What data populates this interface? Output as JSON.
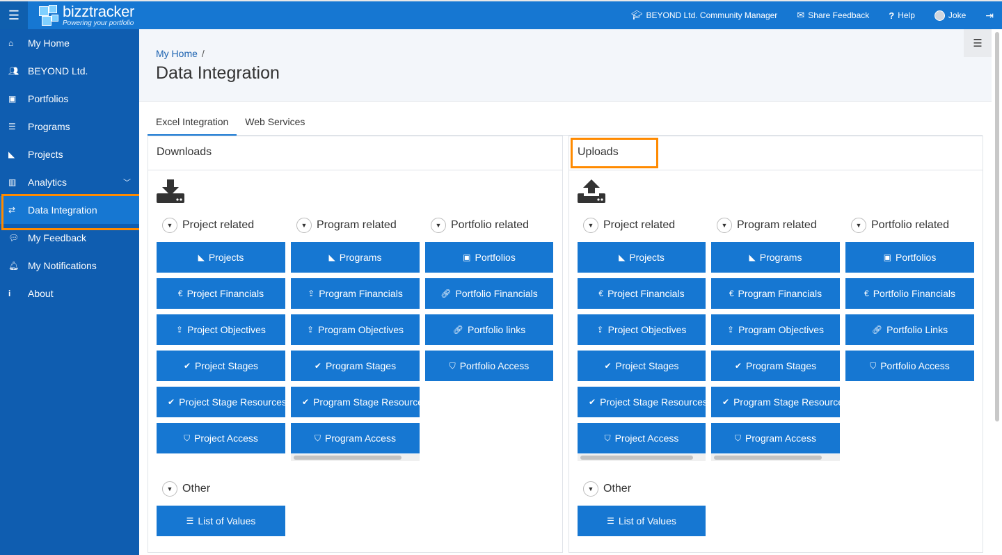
{
  "app": {
    "name": "bizztracker",
    "tagline": "Powering your portfolio"
  },
  "topbar": {
    "community": "BEYOND Ltd. Community Manager",
    "feedback": "Share Feedback",
    "help": "Help",
    "user": "Joke"
  },
  "sidebar": {
    "items": [
      {
        "label": "My Home",
        "icon": "home-icon"
      },
      {
        "label": "BEYOND Ltd.",
        "icon": "users-icon"
      },
      {
        "label": "Portfolios",
        "icon": "briefcase-icon"
      },
      {
        "label": "Programs",
        "icon": "list-icon"
      },
      {
        "label": "Projects",
        "icon": "area-chart-icon"
      },
      {
        "label": "Analytics",
        "icon": "bar-chart-icon"
      },
      {
        "label": "Data Integration",
        "icon": "exchange-icon"
      },
      {
        "label": "My Feedback",
        "icon": "comments-icon"
      },
      {
        "label": "My Notifications",
        "icon": "bell-icon"
      },
      {
        "label": "About",
        "icon": "info-icon"
      }
    ],
    "active": "Data Integration"
  },
  "breadcrumb": {
    "home": "My Home",
    "sep": "/"
  },
  "page": {
    "title": "Data Integration"
  },
  "tabs": [
    {
      "label": "Excel Integration",
      "active": true
    },
    {
      "label": "Web Services",
      "active": false
    }
  ],
  "downloads": {
    "title": "Downloads",
    "project_group": "Project related",
    "program_group": "Program related",
    "portfolio_group": "Portfolio related",
    "other_group": "Other",
    "project_buttons": [
      "Projects",
      "Project Financials",
      "Project Objectives",
      "Project Stages",
      "Project Stage Resources",
      "Project Access"
    ],
    "program_buttons": [
      "Programs",
      "Program Financials",
      "Program Objectives",
      "Program Stages",
      "Program Stage Resources",
      "Program Access"
    ],
    "portfolio_buttons": [
      "Portfolios",
      "Portfolio Financials",
      "Portfolio links",
      "Portfolio Access"
    ],
    "other_buttons": [
      "List of Values"
    ]
  },
  "uploads": {
    "title": "Uploads",
    "project_group": "Project related",
    "program_group": "Program related",
    "portfolio_group": "Portfolio related",
    "other_group": "Other",
    "project_buttons": [
      "Projects",
      "Project Financials",
      "Project Objectives",
      "Project Stages",
      "Project Stage Resources",
      "Project Access"
    ],
    "program_buttons": [
      "Programs",
      "Program Financials",
      "Program Objectives",
      "Program Stages",
      "Program Stage Resources",
      "Program Access"
    ],
    "portfolio_buttons": [
      "Portfolios",
      "Portfolio Financials",
      "Portfolio Links",
      "Portfolio Access"
    ],
    "other_buttons": [
      "List of Values"
    ]
  },
  "colors": {
    "primary": "#1677d2",
    "sidebar": "#0f5db0",
    "highlight": "#ff8a00"
  }
}
